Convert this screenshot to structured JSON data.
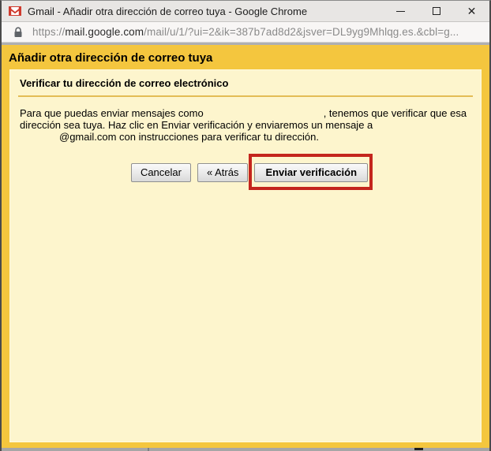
{
  "window": {
    "title": "Gmail - Añadir otra dirección de correo tuya - Google Chrome",
    "icons": {
      "gmail": "gmail-envelope",
      "lock": "padlock",
      "minimize": "–",
      "maximize": "□",
      "close": "✕"
    }
  },
  "address_bar": {
    "scheme": "https://",
    "domain": "mail.google.com",
    "path": "/mail/u/1/?ui=2&ik=387b7ad8d2&jsver=DL9yg9Mhlqg.es.&cbl=g..."
  },
  "dialog": {
    "title": "Añadir otra dirección de correo tuya",
    "section_title": "Verificar tu dirección de correo electrónico",
    "body": {
      "line1_before": "Para que puedas enviar mensajes como",
      "line1_after": ", tenemos que verificar que esa",
      "line2": "dirección sea tuya. Haz clic en Enviar verificación y enviaremos un mensaje a",
      "line3": "@gmail.com con instrucciones para verificar tu dirección."
    },
    "buttons": {
      "cancel": "Cancelar",
      "back": "« Atrás",
      "send": "Enviar verificación"
    }
  },
  "colors": {
    "header_gold": "#F4C63E",
    "panel_yellow": "#FDF5CD",
    "divider_gold": "#E3BC55",
    "annotation_red": "#C4261D",
    "titlebar_gray": "#E8E6E4",
    "urlbar_gray": "#F8F6F5"
  }
}
